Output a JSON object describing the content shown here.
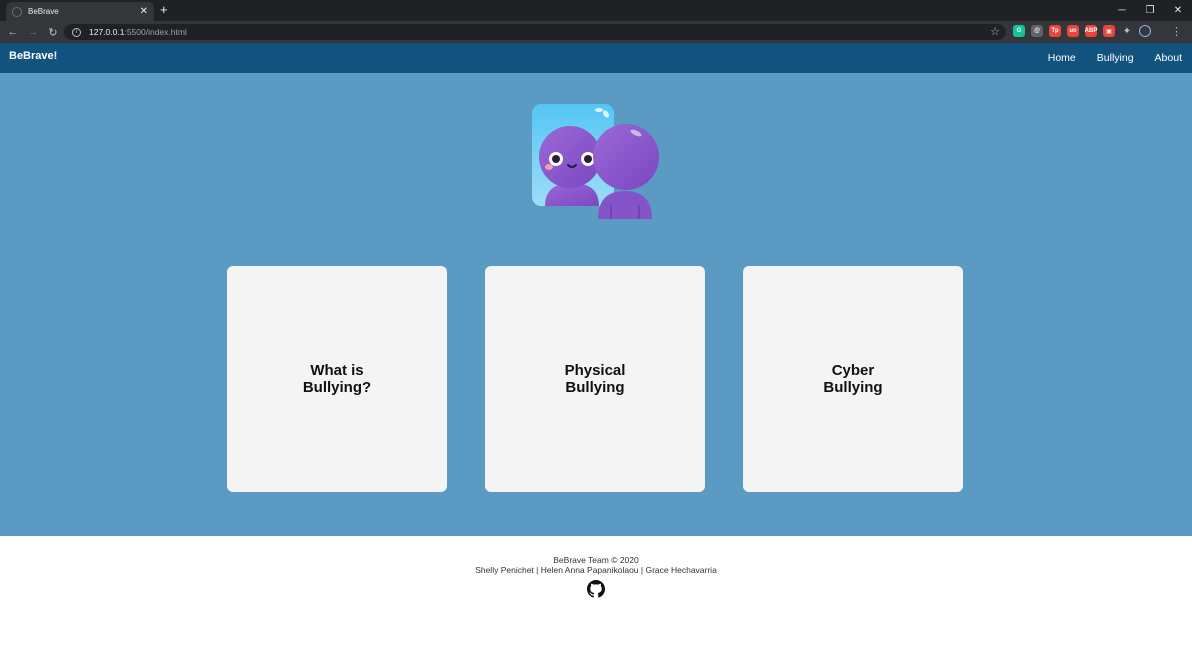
{
  "browser": {
    "tab_title": "BeBrave",
    "url_host": "127.0.0.1",
    "url_rest": ":5500/index.html",
    "extensions": [
      {
        "name": "grammarly-icon",
        "color": "#15c39a",
        "label": "G"
      },
      {
        "name": "extension-icon",
        "color": "#5f6368",
        "label": "@"
      },
      {
        "name": "extension-icon",
        "color": "#e8453c",
        "label": "Tp"
      },
      {
        "name": "extension-icon",
        "color": "#e8453c",
        "label": "uo"
      },
      {
        "name": "adblock-icon",
        "color": "#e8453c",
        "label": "ABP"
      },
      {
        "name": "extension-icon",
        "color": "#e8453c",
        "label": "▣"
      }
    ]
  },
  "site": {
    "brand": "BeBrave!",
    "nav": [
      {
        "label": "Home"
      },
      {
        "label": "Bullying"
      },
      {
        "label": "About"
      }
    ]
  },
  "cards": [
    {
      "title": "What is\nBullying?"
    },
    {
      "title": "Physical\nBullying"
    },
    {
      "title": "Cyber\nBullying"
    }
  ],
  "footer": {
    "team": "BeBrave Team © 2020",
    "authors": "Shelly Penichet | Helen Anna Papanikolaou | Grace Hechavarria"
  },
  "colors": {
    "navbar": "#12527e",
    "hero": "#5b9ac3",
    "card": "#f4f4f4"
  }
}
